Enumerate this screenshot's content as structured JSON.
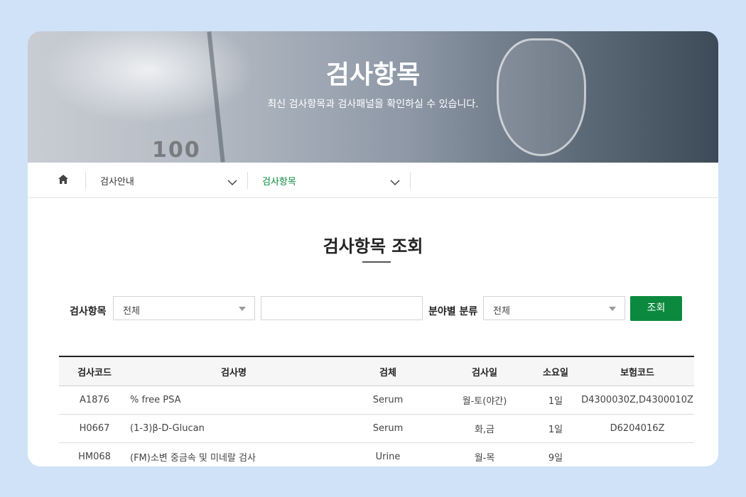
{
  "hero": {
    "title": "검사항목",
    "subtitle": "최신 검사항목과 검사패널을 확인하실 수 있습니다.",
    "image_text": "100"
  },
  "breadcrumb": {
    "home_icon": "home-icon",
    "level1": "검사안내",
    "level2": "검사항목"
  },
  "section": {
    "title": "검사항목 조회"
  },
  "search": {
    "item_label": "검사항목",
    "item_select_value": "전체",
    "text_value": "",
    "category_label": "분야별 분류",
    "category_select_value": "전체",
    "button_label": "조회"
  },
  "table": {
    "headers": [
      "검사코드",
      "검사명",
      "검체",
      "검사일",
      "소요일",
      "보험코드"
    ],
    "rows": [
      [
        "A1876",
        "% free PSA",
        "Serum",
        "월-토(야간)",
        "1일",
        "D4300030Z,D4300010Z"
      ],
      [
        "H0667",
        "(1-3)β-D-Glucan",
        "Serum",
        "화,금",
        "1일",
        "D6204016Z"
      ],
      [
        "HM068",
        "(FM)소변 중금속 및 미네랄 검사",
        "Urine",
        "월-목",
        "9일",
        ""
      ]
    ]
  },
  "colors": {
    "background": "#cfe2f7",
    "accent": "#0b8a3f",
    "active_breadcrumb": "#0a8a3c"
  }
}
